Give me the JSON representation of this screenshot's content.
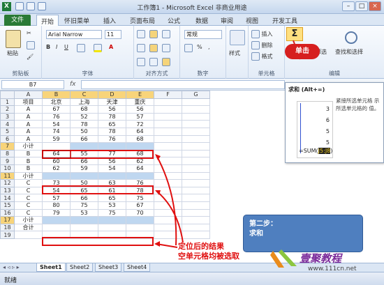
{
  "window": {
    "title": "工作簿1 - Microsoft Excel 非商业用途"
  },
  "ribbon_tabs": {
    "file": "文件",
    "items": [
      "开始",
      "怀旧菜单",
      "插入",
      "页面布局",
      "公式",
      "数据",
      "审阅",
      "视图",
      "开发工具"
    ]
  },
  "clipboard": {
    "paste": "粘贴",
    "label": "剪贴板"
  },
  "font": {
    "name": "Arial Narrow",
    "size": "11",
    "label": "字体"
  },
  "alignment": {
    "label": "对齐方式"
  },
  "number": {
    "format": "常规",
    "label": "数字"
  },
  "styles": {
    "label": "样式"
  },
  "cells": {
    "insert": "插入",
    "delete": "删除",
    "format": "格式",
    "label": "单元格"
  },
  "editing": {
    "filter": "筛选",
    "find_select": "查找和选择",
    "label": "编辑",
    "sigma": "Σ"
  },
  "formula_bar": {
    "name_box": "B7",
    "fx": "fx"
  },
  "sheet": {
    "col_headers": [
      "A",
      "B",
      "C",
      "D",
      "E",
      "F",
      "G"
    ],
    "rows": [
      {
        "n": "1",
        "cells": [
          "项目",
          "北京",
          "上海",
          "天津",
          "重庆"
        ]
      },
      {
        "n": "2",
        "cells": [
          "A",
          "67",
          "68",
          "56",
          "56"
        ]
      },
      {
        "n": "3",
        "cells": [
          "A",
          "76",
          "52",
          "78",
          "57"
        ]
      },
      {
        "n": "4",
        "cells": [
          "A",
          "54",
          "78",
          "65",
          "72"
        ]
      },
      {
        "n": "5",
        "cells": [
          "A",
          "74",
          "50",
          "78",
          "64"
        ]
      },
      {
        "n": "6",
        "cells": [
          "A",
          "59",
          "66",
          "76",
          "68"
        ]
      },
      {
        "n": "7",
        "cells": [
          "小计",
          "",
          "",
          "",
          ""
        ]
      },
      {
        "n": "8",
        "cells": [
          "B",
          "64",
          "55",
          "77",
          "68"
        ]
      },
      {
        "n": "9",
        "cells": [
          "B",
          "60",
          "66",
          "56",
          "62"
        ]
      },
      {
        "n": "10",
        "cells": [
          "B",
          "62",
          "59",
          "54",
          "64"
        ]
      },
      {
        "n": "11",
        "cells": [
          "小计",
          "",
          "",
          "",
          ""
        ]
      },
      {
        "n": "12",
        "cells": [
          "C",
          "73",
          "50",
          "63",
          "76"
        ]
      },
      {
        "n": "13",
        "cells": [
          "C",
          "54",
          "65",
          "61",
          "78"
        ]
      },
      {
        "n": "14",
        "cells": [
          "C",
          "57",
          "66",
          "65",
          "75"
        ]
      },
      {
        "n": "15",
        "cells": [
          "C",
          "80",
          "75",
          "53",
          "67"
        ]
      },
      {
        "n": "16",
        "cells": [
          "C",
          "79",
          "53",
          "75",
          "70"
        ]
      },
      {
        "n": "17",
        "cells": [
          "小计",
          "",
          "",
          "",
          ""
        ]
      },
      {
        "n": "18",
        "cells": [
          "合计",
          "",
          "",
          "",
          ""
        ]
      },
      {
        "n": "19",
        "cells": [
          "",
          "",
          "",
          "",
          ""
        ]
      }
    ]
  },
  "sheet_tabs": [
    "Sheet1",
    "Sheet2",
    "Sheet3",
    "Sheet4"
  ],
  "status": {
    "text": "就绪"
  },
  "tooltip": {
    "title": "求和 (Alt+=)",
    "body": "紧接所选单元格 示所选单元格的 值。",
    "preview_values": [
      "3",
      "6",
      "5",
      "5"
    ],
    "preview_formula": "=SUM(",
    "preview_ref": "J5:J8"
  },
  "annotations": {
    "click": "单击",
    "step_line1": "第二步：",
    "step_line2": "求和",
    "note_line1": "定位后的结果",
    "note_line2": "空单元格均被选取"
  },
  "watermark": {
    "name": "壹聚教程",
    "url": "www.111cn.net"
  },
  "colors": {
    "file_tab": "#2a7a36",
    "accent_red": "#d61f1f",
    "callout": "#4f7fbf",
    "selection_fill": "#bfd7f0"
  }
}
